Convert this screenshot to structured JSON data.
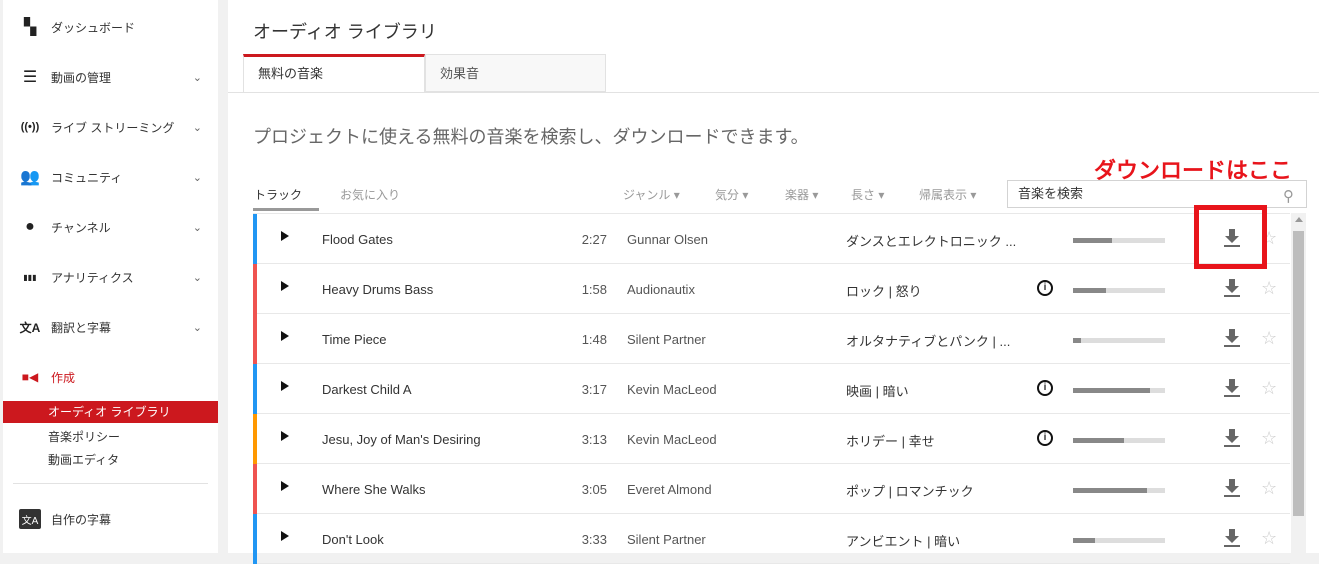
{
  "sidebar": {
    "items": [
      {
        "label": "ダッシュボード",
        "icon": "dashboard-icon",
        "expandable": false
      },
      {
        "label": "動画の管理",
        "icon": "video-manager-icon",
        "expandable": true
      },
      {
        "label": "ライブ ストリーミング",
        "icon": "live-icon",
        "expandable": true
      },
      {
        "label": "コミュニティ",
        "icon": "community-icon",
        "expandable": true
      },
      {
        "label": "チャンネル",
        "icon": "channel-icon",
        "expandable": true
      },
      {
        "label": "アナリティクス",
        "icon": "analytics-icon",
        "expandable": true
      },
      {
        "label": "翻訳と字幕",
        "icon": "translate-icon",
        "expandable": true
      },
      {
        "label": "作成",
        "icon": "create-icon",
        "expandable": false
      }
    ],
    "create_sub": [
      "オーディオ ライブラリ",
      "音楽ポリシー",
      "動画エディタ"
    ],
    "own_subtitles": "自作の字幕"
  },
  "main": {
    "title": "オーディオ ライブラリ",
    "tabs": [
      "無料の音楽",
      "効果音"
    ],
    "description": "プロジェクトに使える無料の音楽を検索し、ダウンロードできます。",
    "annotation": "ダウンロードはここ",
    "subtabs": [
      "トラック",
      "お気に入り"
    ],
    "filters": [
      "ジャンル ▾",
      "気分 ▾",
      "楽器 ▾",
      "長さ ▾",
      "帰属表示 ▾"
    ],
    "search_placeholder": "音楽を検索",
    "accent": "#cc181e",
    "tracks": [
      {
        "name": "Flood Gates",
        "duration": "2:27",
        "artist": "Gunnar Olsen",
        "genre": "ダンスとエレクトロニック ...",
        "attribution": false,
        "popularity": 42,
        "color": "#2196f3"
      },
      {
        "name": "Heavy Drums Bass",
        "duration": "1:58",
        "artist": "Audionautix",
        "genre": "ロック | 怒り",
        "attribution": true,
        "popularity": 36,
        "color": "#ef5350"
      },
      {
        "name": "Time Piece",
        "duration": "1:48",
        "artist": "Silent Partner",
        "genre": "オルタナティブとパンク | ...",
        "attribution": false,
        "popularity": 9,
        "color": "#ef5350"
      },
      {
        "name": "Darkest Child A",
        "duration": "3:17",
        "artist": "Kevin MacLeod",
        "genre": "映画 | 暗い",
        "attribution": true,
        "popularity": 84,
        "color": "#2196f3"
      },
      {
        "name": "Jesu, Joy of Man's Desiring",
        "duration": "3:13",
        "artist": "Kevin MacLeod",
        "genre": "ホリデー | 幸せ",
        "attribution": true,
        "popularity": 55,
        "color": "#ff9800"
      },
      {
        "name": "Where She Walks",
        "duration": "3:05",
        "artist": "Everet Almond",
        "genre": "ポップ | ロマンチック",
        "attribution": false,
        "popularity": 80,
        "color": "#ef5350"
      },
      {
        "name": "Don't Look",
        "duration": "3:33",
        "artist": "Silent Partner",
        "genre": "アンビエント | 暗い",
        "attribution": false,
        "popularity": 24,
        "color": "#2196f3"
      }
    ]
  }
}
